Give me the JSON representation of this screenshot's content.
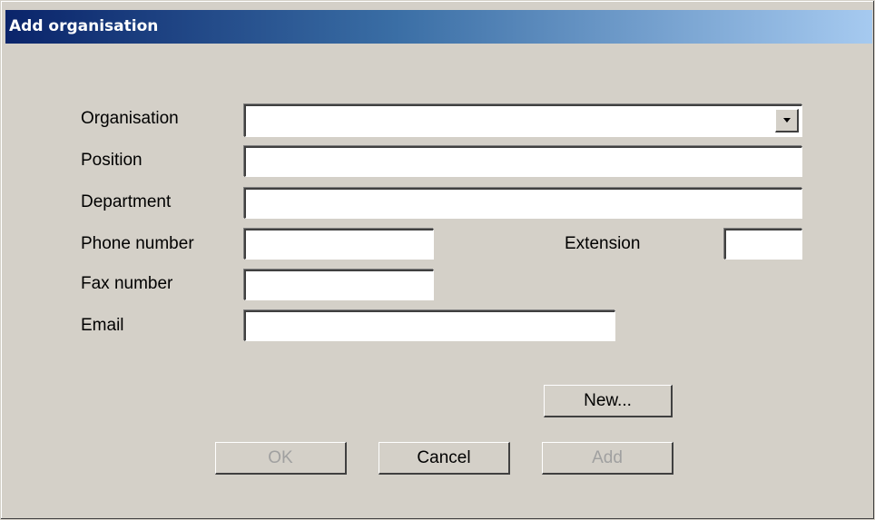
{
  "window": {
    "title": "Add organisation"
  },
  "form": {
    "organisation": {
      "label": "Organisation",
      "value": ""
    },
    "position": {
      "label": "Position",
      "value": ""
    },
    "department": {
      "label": "Department",
      "value": ""
    },
    "phone": {
      "label": "Phone number",
      "value": ""
    },
    "extension": {
      "label": "Extension",
      "value": ""
    },
    "fax": {
      "label": "Fax number",
      "value": ""
    },
    "email": {
      "label": "Email",
      "value": ""
    }
  },
  "buttons": {
    "new": {
      "label": "New...",
      "enabled": true
    },
    "ok": {
      "label": "OK",
      "enabled": false
    },
    "cancel": {
      "label": "Cancel",
      "enabled": true
    },
    "add": {
      "label": "Add",
      "enabled": false
    }
  },
  "colors": {
    "titlebar_start": "#0a246a",
    "titlebar_end": "#a6caf0",
    "dialog_background": "#d4d0c8",
    "disabled_text": "#a0a0a0"
  },
  "icons": {
    "dropdown": "chevron-down-icon"
  }
}
